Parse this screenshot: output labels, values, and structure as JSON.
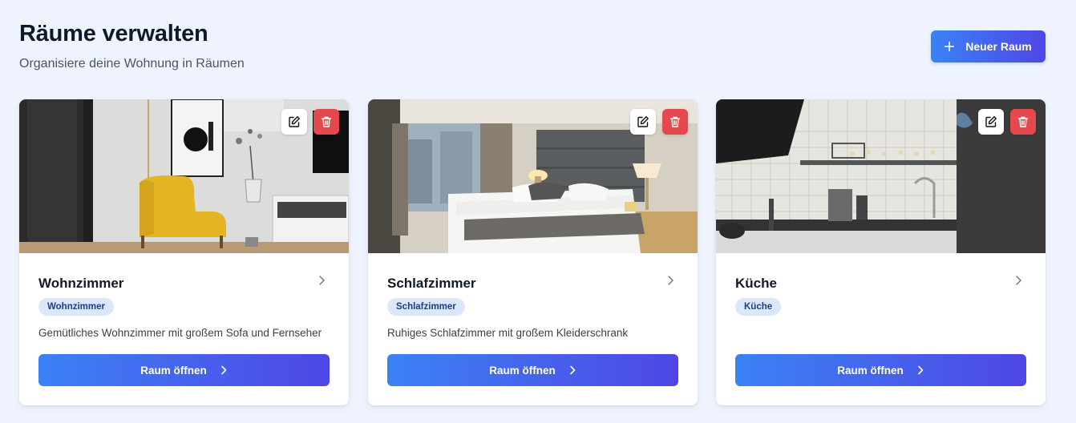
{
  "header": {
    "title": "Räume verwalten",
    "subtitle": "Organisiere deine Wohnung in Räumen",
    "new_room_label": "Neuer Raum"
  },
  "rooms": [
    {
      "name": "Wohnzimmer",
      "type": "Wohnzimmer",
      "description": "Gemütliches Wohnzimmer mit großem Sofa und Fernseher",
      "open_label": "Raum öffnen"
    },
    {
      "name": "Schlafzimmer",
      "type": "Schlafzimmer",
      "description": "Ruhiges Schlafzimmer mit großem Kleiderschrank",
      "open_label": "Raum öffnen"
    },
    {
      "name": "Küche",
      "type": "Küche",
      "description": "",
      "open_label": "Raum öffnen"
    }
  ],
  "icons": {
    "new_room": "plus-icon",
    "edit": "edit-icon",
    "delete": "trash-icon",
    "navigate": "chevron-right-icon"
  },
  "colors": {
    "accent_start": "#3b82f6",
    "accent_end": "#4f46e5",
    "danger": "#e5484d",
    "badge_bg": "#dbe7fb",
    "page_bg": "#eef3fd"
  }
}
